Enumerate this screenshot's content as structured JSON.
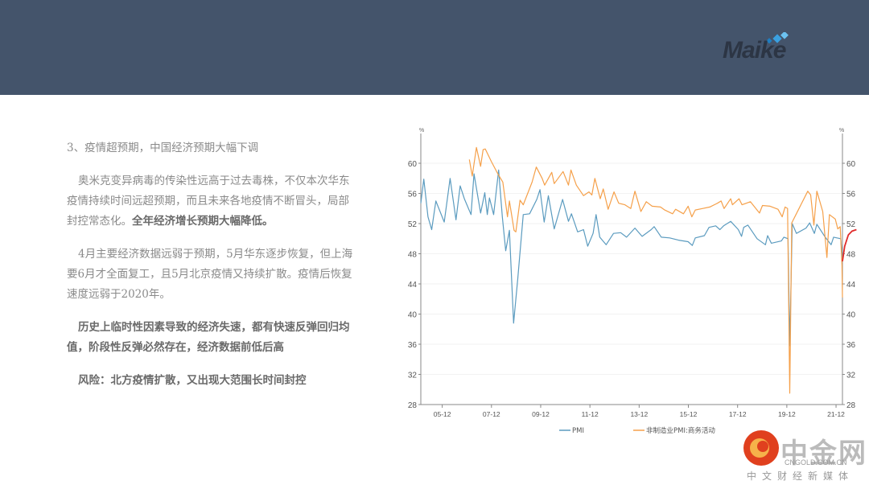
{
  "header": {
    "logo_text": "Maike"
  },
  "content": {
    "heading": "3、疫情超预期，中国经济预期大幅下调",
    "p1_normal": "奥米克变异病毒的传染性远高于过去毒株，不仅本次华东疫情持续时间远超预期，而且未来各地疫情不断冒头，局部封控常态化。",
    "p1_bold": "全年经济增长预期大幅降低。",
    "p2": "4月主要经济数据远弱于预期，5月华东逐步恢复，但上海要6月才全面复工，且5月北京疫情又持续扩散。疫情后恢复速度远弱于2020年。",
    "p3": "历史上临时性因素导致的经济失速，都有快速反弹回归均值，阶段性反弹必然存在，经济数据前低后高",
    "p4": "风险：北方疫情扩散，又出现大范围长时间封控"
  },
  "watermark": {
    "name": "中金网",
    "domain": "CNGOLD.COM.CN",
    "tagline": "中文财经新媒体"
  },
  "chart_data": {
    "type": "line",
    "y_unit_left": "%",
    "y_unit_right": "%",
    "ylim": [
      28,
      64
    ],
    "yticks": [
      28,
      32,
      36,
      40,
      44,
      48,
      52,
      56,
      60
    ],
    "xlim": [
      2005.08,
      2022.21
    ],
    "xticks": [
      {
        "label": "05-12",
        "x": 2005.95
      },
      {
        "label": "07-12",
        "x": 2007.95
      },
      {
        "label": "09-12",
        "x": 2009.95
      },
      {
        "label": "11-12",
        "x": 2011.95
      },
      {
        "label": "13-12",
        "x": 2013.95
      },
      {
        "label": "15-12",
        "x": 2015.95
      },
      {
        "label": "17-12",
        "x": 2017.95
      },
      {
        "label": "19-12",
        "x": 2019.95
      },
      {
        "label": "21-12",
        "x": 2021.95
      }
    ],
    "series": [
      {
        "name": "PMI",
        "color": "#5b9bbf",
        "points": [
          [
            2005.08,
            54.7
          ],
          [
            2005.2,
            57.9
          ],
          [
            2005.37,
            52.9
          ],
          [
            2005.52,
            51.2
          ],
          [
            2005.69,
            55.0
          ],
          [
            2006.03,
            52.2
          ],
          [
            2006.27,
            58.0
          ],
          [
            2006.51,
            52.5
          ],
          [
            2006.68,
            57.0
          ],
          [
            2006.85,
            55.3
          ],
          [
            2007.12,
            53.2
          ],
          [
            2007.24,
            58.6
          ],
          [
            2007.51,
            53.4
          ],
          [
            2007.68,
            56.1
          ],
          [
            2007.78,
            53.2
          ],
          [
            2007.87,
            55.4
          ],
          [
            2008.04,
            53.2
          ],
          [
            2008.24,
            59.1
          ],
          [
            2008.39,
            52.9
          ],
          [
            2008.53,
            48.4
          ],
          [
            2008.68,
            51.1
          ],
          [
            2008.85,
            38.8
          ],
          [
            2009.02,
            44.7
          ],
          [
            2009.24,
            53.2
          ],
          [
            2009.5,
            53.3
          ],
          [
            2009.79,
            55.2
          ],
          [
            2009.92,
            56.5
          ],
          [
            2010.09,
            52.2
          ],
          [
            2010.26,
            55.7
          ],
          [
            2010.5,
            51.3
          ],
          [
            2010.84,
            55.2
          ],
          [
            2011.08,
            52.3
          ],
          [
            2011.2,
            53.3
          ],
          [
            2011.45,
            50.9
          ],
          [
            2011.69,
            51.2
          ],
          [
            2011.86,
            49.0
          ],
          [
            2012.08,
            50.7
          ],
          [
            2012.2,
            53.2
          ],
          [
            2012.35,
            50.2
          ],
          [
            2012.61,
            49.2
          ],
          [
            2012.91,
            50.7
          ],
          [
            2013.2,
            50.8
          ],
          [
            2013.44,
            50.2
          ],
          [
            2013.78,
            51.4
          ],
          [
            2014.07,
            50.3
          ],
          [
            2014.44,
            51.2
          ],
          [
            2014.56,
            51.6
          ],
          [
            2014.85,
            50.2
          ],
          [
            2015.19,
            50.1
          ],
          [
            2015.55,
            49.8
          ],
          [
            2015.94,
            49.6
          ],
          [
            2016.11,
            49.1
          ],
          [
            2016.23,
            50.1
          ],
          [
            2016.6,
            50.4
          ],
          [
            2016.79,
            51.5
          ],
          [
            2017.06,
            51.7
          ],
          [
            2017.23,
            51.2
          ],
          [
            2017.38,
            51.7
          ],
          [
            2017.67,
            52.3
          ],
          [
            2017.98,
            51.2
          ],
          [
            2018.11,
            50.3
          ],
          [
            2018.2,
            51.5
          ],
          [
            2018.37,
            51.8
          ],
          [
            2018.74,
            50.0
          ],
          [
            2019.08,
            49.2
          ],
          [
            2019.17,
            50.4
          ],
          [
            2019.32,
            49.4
          ],
          [
            2019.73,
            49.7
          ],
          [
            2019.83,
            50.2
          ],
          [
            2020.0,
            50.0
          ],
          [
            2020.07,
            35.8
          ],
          [
            2020.17,
            52.0
          ],
          [
            2020.34,
            50.7
          ],
          [
            2020.73,
            51.4
          ],
          [
            2020.88,
            52.1
          ],
          [
            2021.07,
            50.7
          ],
          [
            2021.17,
            51.9
          ],
          [
            2021.51,
            50.2
          ],
          [
            2021.75,
            49.2
          ],
          [
            2021.85,
            50.2
          ],
          [
            2022.14,
            50.0
          ],
          [
            2022.21,
            47.4
          ]
        ]
      },
      {
        "name": "非制造业PMI:商务活动",
        "color": "#f5a04a",
        "points": [
          [
            2007.05,
            60.5
          ],
          [
            2007.17,
            58.3
          ],
          [
            2007.34,
            62.1
          ],
          [
            2007.51,
            59.6
          ],
          [
            2007.61,
            61.8
          ],
          [
            2007.7,
            61.9
          ],
          [
            2007.95,
            60.2
          ],
          [
            2008.21,
            58.6
          ],
          [
            2008.41,
            57.5
          ],
          [
            2008.6,
            52.9
          ],
          [
            2008.68,
            55.0
          ],
          [
            2008.87,
            51.1
          ],
          [
            2008.94,
            50.9
          ],
          [
            2009.11,
            55.1
          ],
          [
            2009.24,
            54.5
          ],
          [
            2009.6,
            57.5
          ],
          [
            2009.77,
            59.5
          ],
          [
            2010.01,
            58.0
          ],
          [
            2010.11,
            57.1
          ],
          [
            2010.4,
            58.8
          ],
          [
            2010.5,
            57.3
          ],
          [
            2010.86,
            58.9
          ],
          [
            2011.08,
            57.1
          ],
          [
            2011.18,
            59.1
          ],
          [
            2011.4,
            57.1
          ],
          [
            2011.69,
            55.7
          ],
          [
            2011.91,
            56.2
          ],
          [
            2012.03,
            55.8
          ],
          [
            2012.15,
            58.0
          ],
          [
            2012.37,
            55.3
          ],
          [
            2012.49,
            56.6
          ],
          [
            2012.69,
            53.9
          ],
          [
            2012.93,
            56.2
          ],
          [
            2013.12,
            54.7
          ],
          [
            2013.37,
            54.5
          ],
          [
            2013.61,
            54.0
          ],
          [
            2013.78,
            56.3
          ],
          [
            2014.02,
            53.6
          ],
          [
            2014.24,
            54.9
          ],
          [
            2014.48,
            54.3
          ],
          [
            2014.82,
            54.2
          ],
          [
            2014.99,
            53.8
          ],
          [
            2015.31,
            53.3
          ],
          [
            2015.43,
            53.9
          ],
          [
            2015.75,
            53.3
          ],
          [
            2015.94,
            54.3
          ],
          [
            2016.09,
            52.9
          ],
          [
            2016.23,
            53.8
          ],
          [
            2016.52,
            54.0
          ],
          [
            2016.82,
            54.2
          ],
          [
            2017.13,
            54.7
          ],
          [
            2017.28,
            55.0
          ],
          [
            2017.4,
            54.0
          ],
          [
            2017.67,
            55.3
          ],
          [
            2017.74,
            54.5
          ],
          [
            2018.01,
            55.3
          ],
          [
            2018.13,
            54.5
          ],
          [
            2018.47,
            54.9
          ],
          [
            2018.84,
            53.4
          ],
          [
            2018.96,
            54.4
          ],
          [
            2019.27,
            54.3
          ],
          [
            2019.59,
            53.9
          ],
          [
            2019.76,
            52.9
          ],
          [
            2019.88,
            54.2
          ],
          [
            2019.98,
            54.0
          ],
          [
            2020.07,
            29.5
          ],
          [
            2020.15,
            52.1
          ],
          [
            2020.46,
            54.1
          ],
          [
            2020.8,
            56.3
          ],
          [
            2020.92,
            55.8
          ],
          [
            2021.05,
            51.8
          ],
          [
            2021.17,
            56.3
          ],
          [
            2021.41,
            53.6
          ],
          [
            2021.58,
            47.5
          ],
          [
            2021.68,
            53.2
          ],
          [
            2021.92,
            52.6
          ],
          [
            2022.02,
            51.3
          ],
          [
            2022.12,
            51.6
          ],
          [
            2022.19,
            46.5
          ],
          [
            2022.21,
            42.2
          ]
        ]
      },
      {
        "name": "forecast",
        "color": "#e02a2a",
        "legend": false,
        "points": [
          [
            2022.21,
            47.0
          ],
          [
            2022.3,
            49.0
          ],
          [
            2022.45,
            50.5
          ],
          [
            2022.6,
            51.0
          ],
          [
            2022.78,
            51.2
          ]
        ]
      }
    ]
  }
}
